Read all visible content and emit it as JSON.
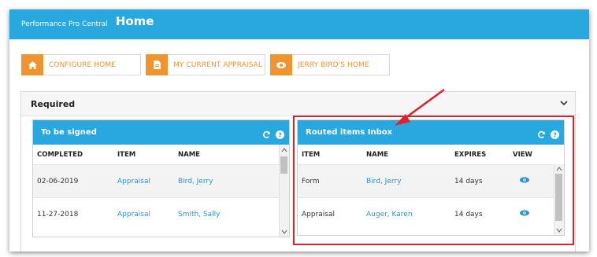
{
  "header": {
    "brand": "Performance Pro Central",
    "title": "Home"
  },
  "tiles": [
    {
      "label": "CONFIGURE HOME",
      "icon": "home-icon"
    },
    {
      "label": "MY CURRENT APPRAISAL",
      "icon": "document-icon"
    },
    {
      "label": "JERRY BIRD'S HOME",
      "icon": "eye-icon"
    }
  ],
  "required": {
    "title": "Required"
  },
  "to_be_signed": {
    "title": "To be signed",
    "columns": [
      "COMPLETED",
      "ITEM",
      "NAME"
    ],
    "rows": [
      {
        "completed": "02-06-2019",
        "item": "Appraisal",
        "name": "Bird, Jerry"
      },
      {
        "completed": "11-27-2018",
        "item": "Appraisal",
        "name": "Smith, Sally"
      }
    ]
  },
  "routed": {
    "title": "Routed items Inbox",
    "columns": [
      "ITEM",
      "NAME",
      "EXPIRES",
      "VIEW"
    ],
    "rows": [
      {
        "item": "Form",
        "name": "Bird, Jerry",
        "expires": "14 days"
      },
      {
        "item": "Appraisal",
        "name": "Auger, Karen",
        "expires": "14 days"
      }
    ]
  },
  "colors": {
    "brand_blue": "#29a8df",
    "accent_orange": "#f0942f",
    "link_blue": "#2a95cb",
    "highlight_red": "#e0202a"
  }
}
